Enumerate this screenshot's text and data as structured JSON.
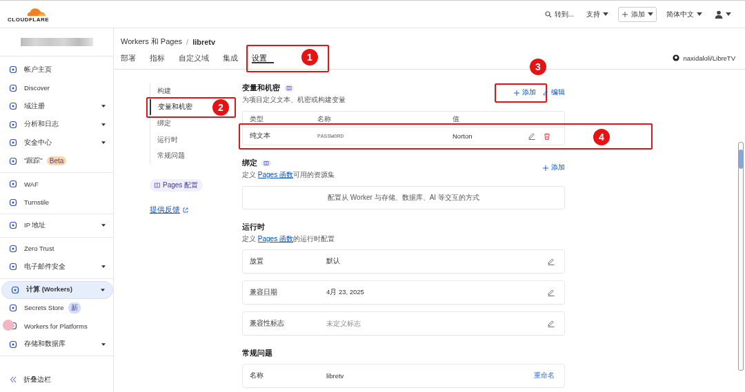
{
  "header": {
    "logo": "CLOUDFLARE",
    "search": "转到...",
    "menus": [
      {
        "label": "支持",
        "kind": "menu"
      },
      {
        "label": "添加",
        "kind": "add"
      },
      {
        "label": "简体中文",
        "kind": "menu"
      }
    ]
  },
  "sidebar": {
    "groups": [
      [
        {
          "label": "帐户主页",
          "has_menu": false,
          "selected": false
        },
        {
          "label": "Discover",
          "has_menu": false,
          "selected": false
        },
        {
          "label": "域注册",
          "has_menu": true,
          "selected": false
        },
        {
          "label": "分析和日志",
          "has_menu": true,
          "selected": false
        },
        {
          "label": "安全中心",
          "has_menu": true,
          "selected": false
        },
        {
          "label": "\"跟踪\"",
          "has_menu": false,
          "selected": false,
          "badge": {
            "text": "Beta",
            "color": "#fbd7b0"
          }
        }
      ],
      [
        {
          "label": "WAF",
          "has_menu": false,
          "selected": false
        },
        {
          "label": "Turnstile",
          "has_menu": false,
          "selected": false
        }
      ],
      [
        {
          "label": "IP 地址",
          "has_menu": true,
          "selected": false
        }
      ],
      [
        {
          "label": "Zero Trust",
          "has_menu": false,
          "selected": false
        },
        {
          "label": "电子邮件安全",
          "has_menu": true,
          "selected": false
        }
      ],
      [
        {
          "label": "计算 (Workers)",
          "has_menu": true,
          "selected": true
        },
        {
          "label": "Secrets Store",
          "has_menu": false,
          "selected": false,
          "badge": {
            "text": "新",
            "color": "#cfe0fb"
          }
        },
        {
          "label": "Workers for Platforms",
          "has_menu": false,
          "selected": false
        },
        {
          "label": "存储和数据库",
          "has_menu": true,
          "selected": false
        }
      ]
    ],
    "collapse": "折叠边栏"
  },
  "breadcrumb": {
    "parent": "Workers 和 Pages",
    "separator": "/",
    "current": "libretv"
  },
  "tabs": [
    {
      "label": "部署",
      "selected": false
    },
    {
      "label": "指标",
      "selected": false
    },
    {
      "label": "自定义域",
      "selected": false
    },
    {
      "label": "集成",
      "selected": false
    },
    {
      "label": "设置",
      "selected": true,
      "annotation": "1"
    }
  ],
  "repo": "naxidaloli/LibreTV",
  "subnav": {
    "items": [
      {
        "label": "构建",
        "selected": false
      },
      {
        "label": "变量和机密",
        "selected": true,
        "annotation": "2"
      },
      {
        "label": "绑定",
        "selected": false
      },
      {
        "label": "运行时",
        "selected": false
      },
      {
        "label": "常规问题",
        "selected": false
      }
    ],
    "docs_badge": "Pages 配置",
    "feedback": "提供反馈"
  },
  "sections": [
    {
      "kind": "variables",
      "title": "变量和机密",
      "desc": "为项目定义文本、机密或构建变量",
      "actions": [
        {
          "label": "添加",
          "kind": "add",
          "annotation": "3"
        },
        {
          "label": "编辑",
          "kind": "edit"
        }
      ],
      "columns": [
        "类型",
        "名称",
        "值"
      ],
      "rows": [
        {
          "type": "纯文本",
          "name": "PASSWORD",
          "value": "Norton",
          "annotation": "4"
        }
      ]
    },
    {
      "kind": "bindings",
      "title": "绑定",
      "desc_prefix": "定义 ",
      "link": "Pages 函数",
      "desc_suffix": "可用的资源集",
      "actions": [
        {
          "label": "添加",
          "kind": "add"
        }
      ],
      "empty": "配置从 Worker 与存储、数据库、AI 等交互的方式"
    },
    {
      "kind": "runtime",
      "title": "运行时",
      "desc_prefix": "定义 ",
      "link": "Pages 函数",
      "desc_suffix": "的运行时配置",
      "rows": [
        {
          "label": "放置",
          "value": "默认",
          "muted": false
        },
        {
          "label": "兼容日期",
          "value": "4月 23, 2025",
          "muted": false
        },
        {
          "label": "兼容性标志",
          "value": "未定义标志",
          "muted": true
        }
      ]
    },
    {
      "kind": "general",
      "title": "常规问题",
      "rows": [
        {
          "label": "名称",
          "value": "libretv",
          "action": "重命名"
        }
      ]
    }
  ]
}
